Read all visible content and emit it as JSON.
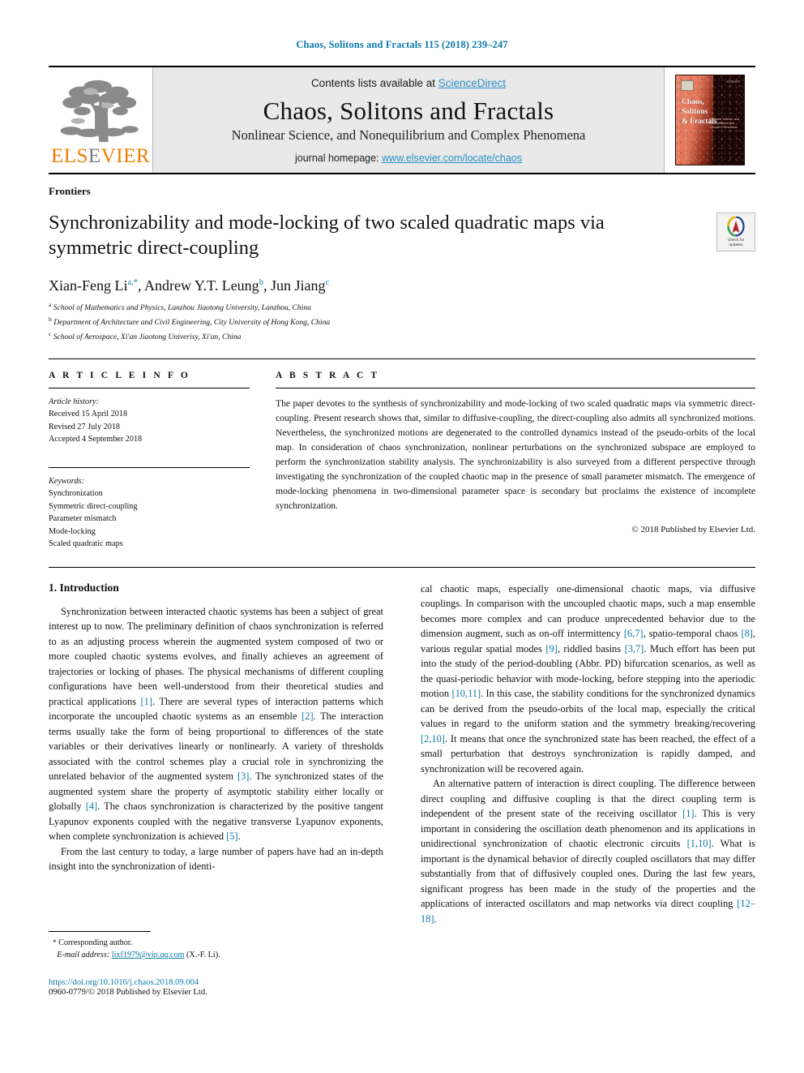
{
  "running_head": "Chaos, Solitons and Fractals 115 (2018) 239–247",
  "masthead": {
    "publisher_logo_name": "ELSEVIER",
    "publisher_word_1": "ELS",
    "publisher_word_2": "E",
    "publisher_word_3": "VIER",
    "contents_prefix": "Contents lists available at ",
    "contents_link": "ScienceDirect",
    "journal_title": "Chaos, Solitons and Fractals",
    "journal_subtitle": "Nonlinear Science, and Nonequilibrium and Complex Phenomena",
    "homepage_prefix": "journal homepage: ",
    "homepage_url": "www.elsevier.com/locate/chaos",
    "cover_title": "Chaos,\nSolitons\n& Fractals",
    "cover_title_line1": "Chaos,",
    "cover_title_line2": "Solitons",
    "cover_title_line3": "& Fractals",
    "cover_subtitle": "Nonlinear Science, and Nonequilibrium and Complex Phenomena",
    "cover_corner": "ELSEVIER"
  },
  "article": {
    "section_type": "Frontiers",
    "title": "Synchronizability and mode-locking of two scaled quadratic maps via symmetric direct-coupling",
    "crossmark_label": "Check for\nupdates",
    "crossmark_label_line1": "Check for",
    "crossmark_label_line2": "updates",
    "authors_plain": "Xian-Feng Li, Andrew Y.T. Leung, Jun Jiang",
    "authors": [
      {
        "name": "Xian-Feng Li",
        "marks": "a,*"
      },
      {
        "name": "Andrew Y.T. Leung",
        "marks": "b"
      },
      {
        "name": "Jun Jiang",
        "marks": "c"
      }
    ],
    "affiliations": [
      {
        "mark": "a",
        "text": "School of Mathematics and Physics, Lanzhou Jiaotong University, Lanzhou, China"
      },
      {
        "mark": "b",
        "text": "Department of Architecture and Civil Engineering, City University of Hong Kong, China"
      },
      {
        "mark": "c",
        "text": "School of Aerospace, Xi'an Jiaotong Univerisy, Xi'an, China"
      }
    ]
  },
  "article_info": {
    "heading": "A R T I C L E   I N F O",
    "history_label": "Article history:",
    "history": [
      "Received 15 April 2018",
      "Revised 27 July 2018",
      "Accepted 4 September 2018"
    ],
    "keywords_label": "Keywords:",
    "keywords": [
      "Synchronization",
      "Symmetric direct-coupling",
      "Parameter mismatch",
      "Mode-locking",
      "Scaled quadratic maps"
    ]
  },
  "abstract": {
    "heading": "A B S T R A C T",
    "text": "The paper devotes to the synthesis of synchronizability and mode-locking of two scaled quadratic maps via symmetric direct-coupling. Present research shows that, similar to diffusive-coupling, the direct-coupling also admits all synchronized motions. Nevertheless, the synchronized motions are degenerated to the controlled dynamics instead of the pseudo-orbits of the local map. In consideration of chaos synchronization, nonlinear perturbations on the synchronized subspace are employed to perform the synchronization stability analysis. The synchronizability is also surveyed from a different perspective through investigating the synchronization of the coupled chaotic map in the presence of small parameter mismatch. The emergence of mode-locking phenomena in two-dimensional parameter space is secondary but proclaims the existence of incomplete synchronization.",
    "copyright": "© 2018 Published by Elsevier Ltd."
  },
  "body": {
    "section_heading": "1. Introduction",
    "left_paragraphs": [
      "Synchronization between interacted chaotic systems has been a subject of great interest up to now. The preliminary definition of chaos synchronization is referred to as an adjusting process wherein the augmented system composed of two or more coupled chaotic systems evolves, and finally achieves an agreement of trajectories or locking of phases. The physical mechanisms of different coupling configurations have been well-understood from their theoretical studies and practical applications [1]. There are several types of interaction patterns which incorporate the uncoupled chaotic systems as an ensemble [2]. The interaction terms usually take the form of being proportional to differences of the state variables or their derivatives linearly or nonlinearly. A variety of thresholds associated with the control schemes play a crucial role in synchronizing the unrelated behavior of the augmented system [3]. The synchronized states of the augmented system share the property of asymptotic stability either locally or globally [4]. The chaos synchronization is characterized by the positive tangent Lyapunov exponents coupled with the negative transverse Lyapunov exponents, when complete synchronization is achieved [5].",
      "From the last century to today, a large number of papers have had an in-depth insight into the synchronization of identi-"
    ],
    "right_paragraphs": [
      "cal chaotic maps, especially one-dimensional chaotic maps, via diffusive couplings. In comparison with the uncoupled chaotic maps, such a map ensemble becomes more complex and can produce unprecedented behavior due to the dimension augment, such as on-off intermittency [6,7], spatio-temporal chaos [8], various regular spatial modes [9], riddled basins [3,7]. Much effort has been put into the study of the period-doubling (Abbr. PD) bifurcation scenarios, as well as the quasi-periodic behavior with mode-locking, before stepping into the aperiodic motion [10,11]. In this case, the stability conditions for the synchronized dynamics can be derived from the pseudo-orbits of the local map, especially the critical values in regard to the uniform station and the symmetry breaking/recovering [2,10]. It means that once the synchronized state has been reached, the effect of a small perturbation that destroys synchronization is rapidly damped, and synchronization will be recovered again.",
      "An alternative pattern of interaction is direct coupling. The difference between direct coupling and diffusive coupling is that the direct coupling term is independent of the present state of the receiving oscillator [1]. This is very important in considering the oscillation death phenomenon and its applications in unidirectional synchronization of chaotic electronic circuits [1,10]. What is important is the dynamical behavior of directly coupled oscillators that may differ substantially from that of diffusively coupled ones. During the last few years, significant progress has been made in the study of the properties and the applications of interacted oscillators and map networks via direct coupling [12–18]."
    ]
  },
  "footer": {
    "corresponding_marker": "*",
    "corresponding_label": "Corresponding author.",
    "email_label": "E-mail address:",
    "email": "lixf1979@vip.qq.com",
    "email_attrib": "(X.-F. Li).",
    "doi": "https://doi.org/10.1016/j.chaos.2018.09.004",
    "issn_line": "0960-0779/© 2018 Published by Elsevier Ltd."
  },
  "colors": {
    "link": "#0b7aa8",
    "elsevier_orange": "#f07d00",
    "masthead_bg": "#e9e9e9"
  }
}
